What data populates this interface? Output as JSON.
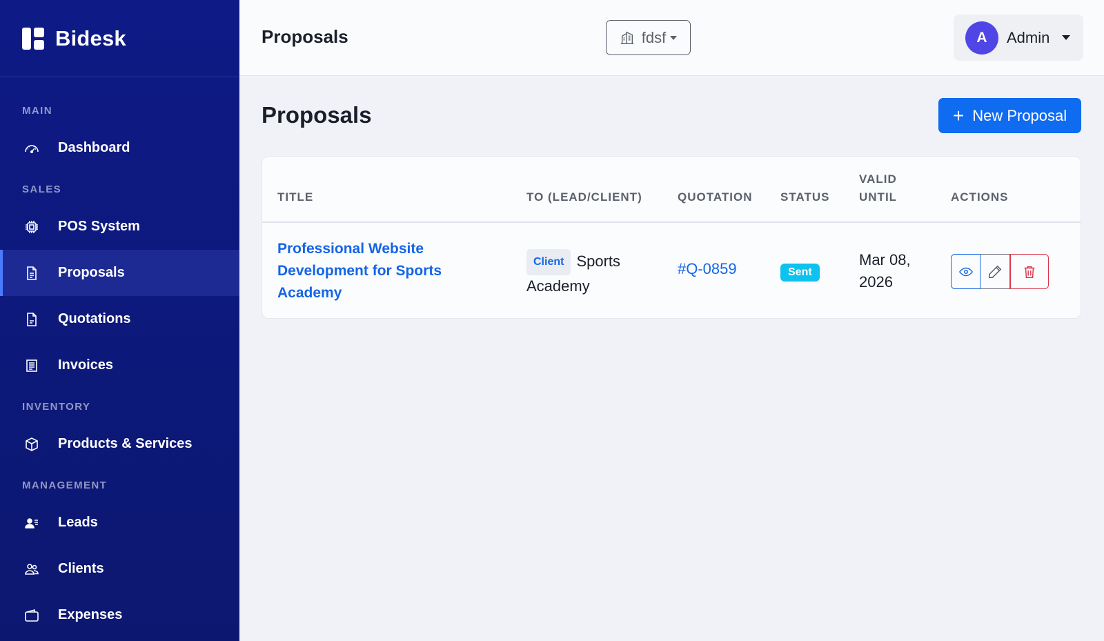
{
  "brand": {
    "name": "Bidesk"
  },
  "sidebar": {
    "sections": [
      {
        "label": "MAIN"
      },
      {
        "label": "SALES"
      },
      {
        "label": "INVENTORY"
      },
      {
        "label": "MANAGEMENT"
      }
    ],
    "items": [
      {
        "label": "Dashboard",
        "icon": "speedometer-icon"
      },
      {
        "label": "POS System",
        "icon": "cpu-icon"
      },
      {
        "label": "Proposals",
        "icon": "file-text-icon",
        "active": true
      },
      {
        "label": "Quotations",
        "icon": "file-icon"
      },
      {
        "label": "Invoices",
        "icon": "receipt-icon"
      },
      {
        "label": "Products & Services",
        "icon": "box-icon"
      },
      {
        "label": "Leads",
        "icon": "person-lines-icon"
      },
      {
        "label": "Clients",
        "icon": "people-icon"
      },
      {
        "label": "Expenses",
        "icon": "wallet-icon"
      }
    ]
  },
  "header": {
    "title": "Proposals",
    "company": "fdsf",
    "user": {
      "initial": "A",
      "name": "Admin"
    }
  },
  "main": {
    "title": "Proposals",
    "new_button": "New Proposal",
    "table": {
      "columns": [
        "TITLE",
        "TO (LEAD/CLIENT)",
        "QUOTATION",
        "STATUS",
        "VALID",
        "UNTIL",
        "ACTIONS"
      ],
      "rows": [
        {
          "title": "Professional Website Development for Sports Academy",
          "to_type": "Client",
          "to_name": "Sports Academy",
          "quotation": "#Q-0859",
          "status": "Sent",
          "valid_until": "Mar 08, 2026"
        }
      ]
    }
  },
  "colors": {
    "sidebar": "#0e1a86",
    "accent": "#0f6bf0",
    "link": "#1565e6",
    "status_sent": "#0dc2ee",
    "danger": "#d9364a",
    "avatar": "#5046e5"
  }
}
